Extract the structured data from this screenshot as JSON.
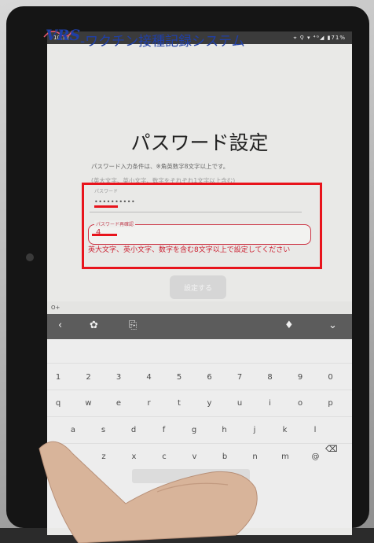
{
  "status": {
    "time": "10:32",
    "icons": "⌖ ⚲ ▾ ⁴ᴳ◢ ▮71%"
  },
  "logo": {
    "brand": "VRS",
    "rest": "-ワクチン接種記録システム"
  },
  "page": {
    "title": "パスワード設定",
    "hint_line1": "パスワード入力条件は、※角英数字8文字以上です。",
    "hint_line2": "(英大文字、英小文字、数字をそれぞれ1文字以上含む)"
  },
  "form": {
    "password_label": "パスワード",
    "password_value": "••••••••••",
    "confirm_label": "パスワード再確認",
    "confirm_value": "4",
    "error": "英大文字、英小文字、数字を含む8文字以上で設定してください"
  },
  "submit_label": "設定する",
  "keyboard": {
    "toggle": "O+",
    "row1": [
      "1",
      "2",
      "3",
      "4",
      "5",
      "6",
      "7",
      "8",
      "9",
      "0"
    ],
    "row2": [
      "q",
      "w",
      "e",
      "r",
      "t",
      "y",
      "u",
      "i",
      "o",
      "p"
    ],
    "row3": [
      "a",
      "s",
      "d",
      "f",
      "g",
      "h",
      "j",
      "k",
      "l"
    ],
    "row4": [
      "z",
      "x",
      "c",
      "v",
      "b",
      "n",
      "m",
      "@"
    ],
    "toolbar": {
      "back": "‹",
      "settings": "✿",
      "clip": "⎘",
      "mic": "♦",
      "collapse": "⌄"
    }
  },
  "colors": {
    "brand_blue": "#1f3fa8",
    "error_red": "#cc2233",
    "annotation_red": "#e8141c"
  }
}
